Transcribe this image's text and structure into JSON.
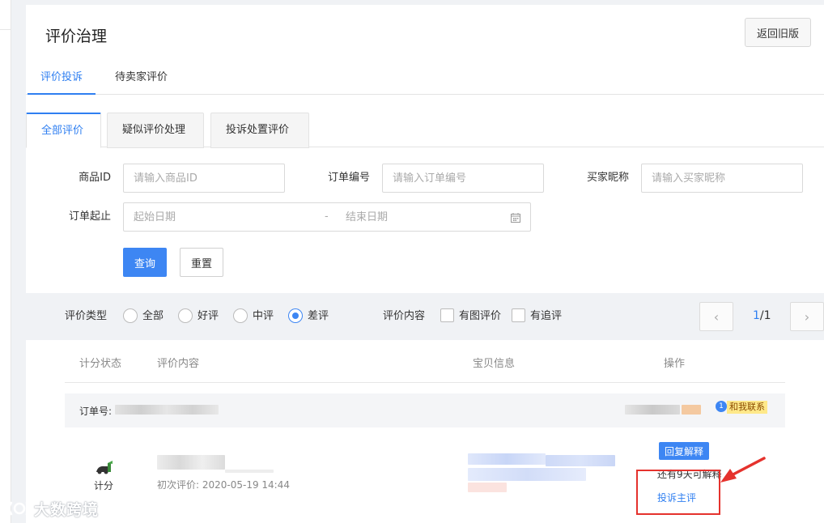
{
  "header": {
    "title": "评价治理",
    "old_version_button": "返回旧版"
  },
  "top_tabs": [
    {
      "label": "评价投诉",
      "active": true
    },
    {
      "label": "待卖家评价",
      "active": false
    }
  ],
  "sub_tabs": [
    {
      "label": "全部评价",
      "active": true
    },
    {
      "label": "疑似评价处理",
      "active": false
    },
    {
      "label": "投诉处置评价",
      "active": false
    }
  ],
  "form": {
    "product_id": {
      "label": "商品ID",
      "placeholder": "请输入商品ID"
    },
    "order_no": {
      "label": "订单编号",
      "placeholder": "请输入订单编号"
    },
    "buyer_nick": {
      "label": "买家昵称",
      "placeholder": "请输入买家昵称"
    },
    "order_date": {
      "label": "订单起止",
      "start_placeholder": "起始日期",
      "separator": "-",
      "end_placeholder": "结束日期"
    },
    "query_button": "查询",
    "reset_button": "重置"
  },
  "filters": {
    "type_label": "评价类型",
    "types": [
      {
        "label": "全部",
        "selected": false
      },
      {
        "label": "好评",
        "selected": false
      },
      {
        "label": "中评",
        "selected": false
      },
      {
        "label": "差评",
        "selected": true
      }
    ],
    "content_label": "评价内容",
    "content_options": [
      {
        "label": "有图评价",
        "checked": false
      },
      {
        "label": "有追评",
        "checked": false
      }
    ]
  },
  "pagination": {
    "current": "1",
    "total": "/1"
  },
  "table": {
    "headers": [
      "计分状态",
      "评价内容",
      "宝贝信息",
      "操作"
    ],
    "order_prefix": "订单号: 9",
    "contact_badge": "1",
    "contact_label": "和我联系",
    "row": {
      "score_status": "计分",
      "first_eval": "初次评价: 2020-05-19 14:44",
      "reply_button": "回复解释",
      "days_left": "还有9天可解释",
      "complain_link": "投诉主评"
    }
  },
  "watermark": "大数跨境",
  "colors": {
    "primary": "#3d86f3",
    "highlight": "#e5322d",
    "badge_bg": "#ffe98a"
  }
}
